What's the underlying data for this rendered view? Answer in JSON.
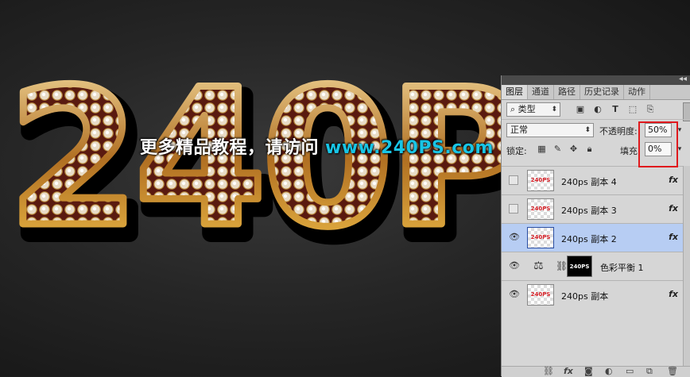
{
  "artwork": {
    "big_text": "240P",
    "watermark_cn": "更多精品教程，请访问",
    "watermark_url": "www.240PS.com"
  },
  "panel": {
    "collapse_icon": "◂◂",
    "tabs": [
      {
        "label": "图层",
        "active": true
      },
      {
        "label": "通道",
        "active": false
      },
      {
        "label": "路径",
        "active": false
      },
      {
        "label": "历史记录",
        "active": false
      },
      {
        "label": "动作",
        "active": false
      }
    ],
    "filter": {
      "search_icon": "⌕",
      "kind_label": "类型"
    },
    "blend_mode": "正常",
    "opacity_label": "不透明度:",
    "opacity_value": "50%",
    "lock_label": "锁定:",
    "fill_label": "填充:",
    "fill_value": "0%",
    "layers": [
      {
        "name": "240ps 副本 4",
        "thumb": "240PS",
        "visible": false,
        "selected": false,
        "fx": "fx"
      },
      {
        "name": "240ps 副本 3",
        "thumb": "240PS",
        "visible": false,
        "selected": false,
        "fx": "fx"
      },
      {
        "name": "240ps 副本 2",
        "thumb": "240PS",
        "visible": true,
        "selected": true,
        "fx": "fx"
      },
      {
        "name": "色彩平衡 1",
        "thumb": "240PS",
        "visible": true,
        "selected": false,
        "adjustment": true,
        "mask_text": "240PS"
      },
      {
        "name": "240ps 副本",
        "thumb": "240PS",
        "visible": true,
        "selected": false,
        "fx": "fx"
      }
    ]
  }
}
